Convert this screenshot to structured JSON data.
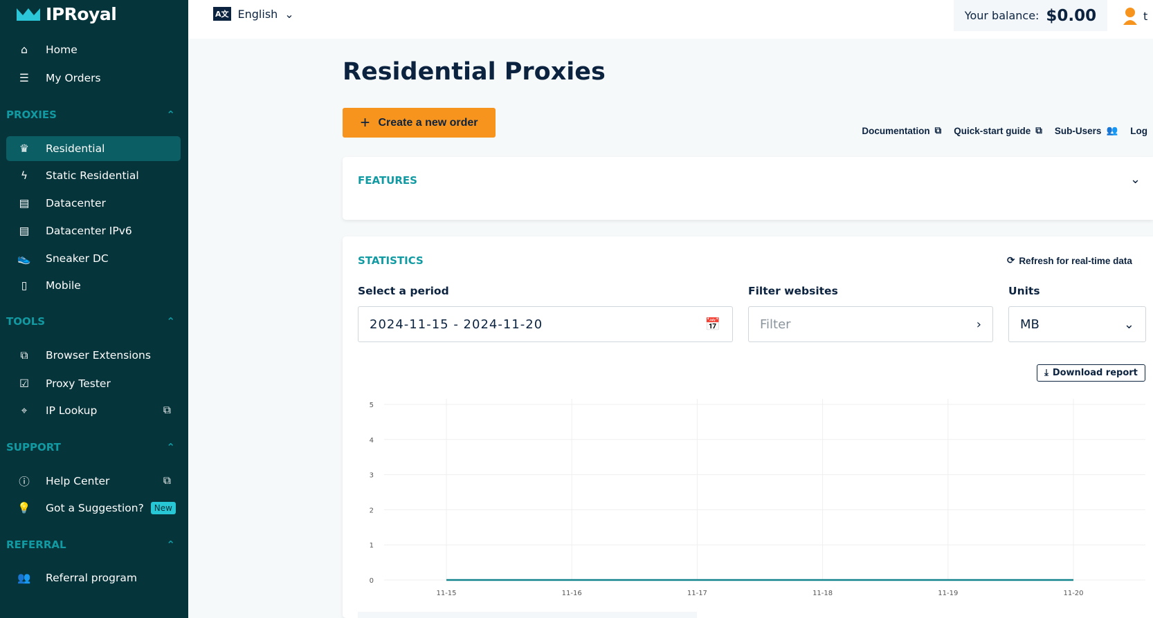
{
  "brand": "IPRoyal",
  "header": {
    "language": "English",
    "balance_label": "Your balance:",
    "balance_value": "$0.00",
    "user_initial": "t"
  },
  "sidebar": {
    "top": [
      {
        "label": "Home",
        "icon": "home-icon"
      },
      {
        "label": "My Orders",
        "icon": "orders-icon"
      }
    ],
    "sections": [
      {
        "title": "PROXIES",
        "items": [
          {
            "label": "Residential",
            "icon": "crown-icon",
            "active": true
          },
          {
            "label": "Static Residential",
            "icon": "bolt-icon"
          },
          {
            "label": "Datacenter",
            "icon": "server-icon"
          },
          {
            "label": "Datacenter IPv6",
            "icon": "server-icon"
          },
          {
            "label": "Sneaker DC",
            "icon": "sneaker-icon"
          },
          {
            "label": "Mobile",
            "icon": "mobile-icon"
          }
        ]
      },
      {
        "title": "TOOLS",
        "items": [
          {
            "label": "Browser Extensions",
            "icon": "extension-icon"
          },
          {
            "label": "Proxy Tester",
            "icon": "checklist-icon"
          },
          {
            "label": "IP Lookup",
            "icon": "location-icon",
            "external": true
          }
        ]
      },
      {
        "title": "SUPPORT",
        "items": [
          {
            "label": "Help Center",
            "icon": "info-icon",
            "external": true
          },
          {
            "label": "Got a Suggestion?",
            "icon": "bulb-icon",
            "badge": "New"
          }
        ]
      },
      {
        "title": "REFERRAL",
        "items": [
          {
            "label": "Referral program",
            "icon": "users-icon"
          }
        ]
      }
    ]
  },
  "main": {
    "title": "Residential Proxies",
    "create_button": "Create a new order",
    "links": [
      "Documentation",
      "Quick-start guide",
      "Sub-Users",
      "Log"
    ],
    "features_title": "FEATURES",
    "statistics": {
      "title": "STATISTICS",
      "refresh": "Refresh for real-time data",
      "period_label": "Select a period",
      "period_value": "2024-11-15 - 2024-11-20",
      "filter_label": "Filter websites",
      "filter_placeholder": "Filter",
      "units_label": "Units",
      "units_value": "MB",
      "download": "Download report"
    }
  },
  "colors": {
    "sidebar": "#05343a",
    "accent": "#129aa3",
    "orange": "#f7941d",
    "line": "#12848c"
  },
  "chart_data": {
    "type": "line",
    "x": [
      "11-15",
      "11-16",
      "11-17",
      "11-18",
      "11-19",
      "11-20"
    ],
    "values": [
      0,
      0,
      0,
      0,
      0,
      0
    ],
    "yticks": [
      0,
      1,
      2,
      3,
      4,
      5
    ],
    "ylim": [
      0,
      5
    ],
    "grid": true
  }
}
